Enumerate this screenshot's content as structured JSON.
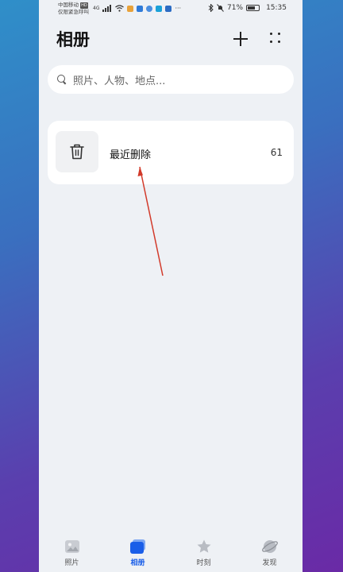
{
  "status_bar": {
    "carrier_line1": "中国移动",
    "carrier_badge": "HD",
    "carrier_line2": "仅限紧急呼叫",
    "network": "4G",
    "battery": "71%",
    "battery_level": 0.71,
    "time": "15:35",
    "more_dots": "···"
  },
  "header": {
    "title": "相册",
    "add_icon": "plus-icon",
    "more_icon": "grid-dots-icon"
  },
  "search": {
    "placeholder": "照片、人物、地点..."
  },
  "albums": [
    {
      "name": "最近删除",
      "count": "61",
      "icon": "trash-icon"
    }
  ],
  "tabbar": {
    "tabs": [
      {
        "label": "照片",
        "icon": "photo-icon",
        "active": false
      },
      {
        "label": "相册",
        "icon": "album-icon",
        "active": true
      },
      {
        "label": "时刻",
        "icon": "star-icon",
        "active": false
      },
      {
        "label": "发现",
        "icon": "planet-icon",
        "active": false
      }
    ]
  },
  "colors": {
    "accent": "#1a5ee8",
    "annotation_arrow": "#d23a2a",
    "background": "#eef1f5"
  }
}
